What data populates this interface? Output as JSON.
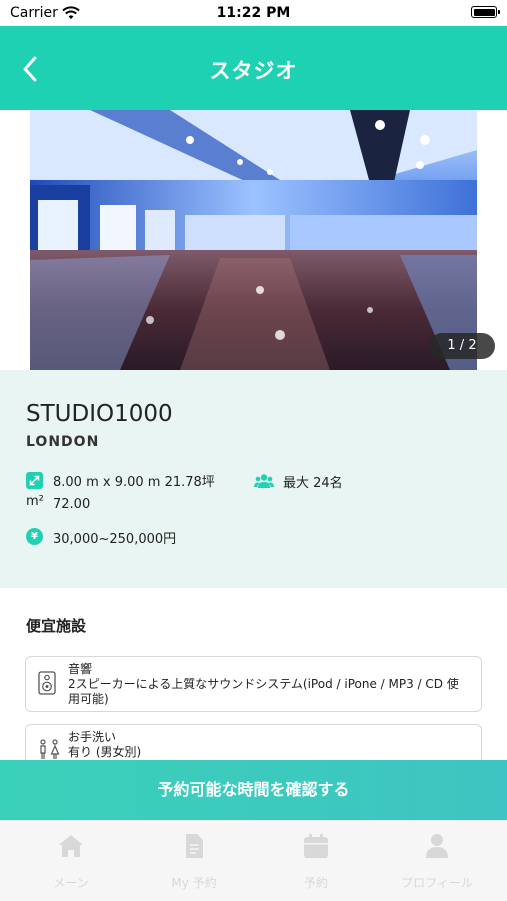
{
  "status_bar": {
    "carrier": "Carrier",
    "time": "11:22 PM"
  },
  "header": {
    "title": "スタジオ"
  },
  "gallery": {
    "counter": "1 / 2"
  },
  "studio": {
    "name": "STUDIO1000",
    "location": "LONDON",
    "size_line1": "8.00 m x 9.00 m 21.78坪 72.00",
    "size_line2": "m²",
    "capacity": "最大 24名",
    "price": "30,000~250,000円",
    "yen_symbol": "¥"
  },
  "facilities": {
    "title": "便宜施設",
    "items": [
      {
        "name": "音響",
        "description": "2スピーカーによる上質なサウンドシステム(iPod / iPone / MP3 / CD 使用可能)",
        "icon": "speaker-icon"
      },
      {
        "name": "お手洗い",
        "description": "有り (男女別)",
        "icon": "restroom-icon"
      }
    ]
  },
  "cta": {
    "label": "予約可能な時間を確認する"
  },
  "tabs": [
    {
      "label": "メーン",
      "icon": "home-icon"
    },
    {
      "label": "My 予約",
      "icon": "document-icon"
    },
    {
      "label": "予約",
      "icon": "calendar-icon"
    },
    {
      "label": "プロフィール",
      "icon": "person-icon"
    }
  ],
  "colors": {
    "accent": "#1fd1b3",
    "info_bg": "#e9f5f2",
    "tab_inactive": "#d8d8d8"
  }
}
